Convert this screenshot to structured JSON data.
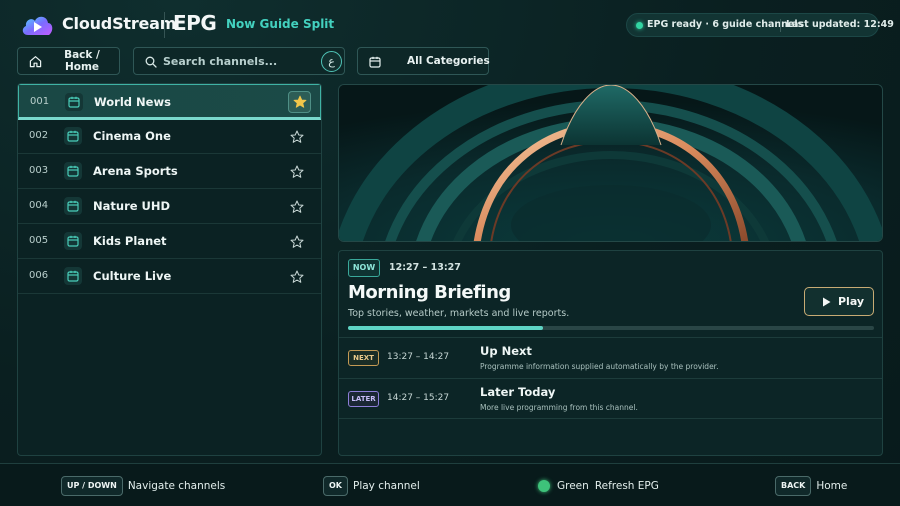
{
  "app": {
    "brand": "CloudStream",
    "section": "EPG",
    "view": "Now Guide Split"
  },
  "status": {
    "ready_text": "EPG ready · 6 guide channels",
    "updated_text": "Last updated: 12:49"
  },
  "toolbar": {
    "home_label": "Back / Home",
    "search_placeholder": "Search channels...",
    "search_value": "",
    "keyboard_badge": "ع",
    "category_label": "All Categories"
  },
  "channels": [
    {
      "number": "001",
      "name": "World News",
      "favorite": true,
      "selected": true
    },
    {
      "number": "002",
      "name": "Cinema One",
      "favorite": false,
      "selected": false
    },
    {
      "number": "003",
      "name": "Arena Sports",
      "favorite": false,
      "selected": false
    },
    {
      "number": "004",
      "name": "Nature UHD",
      "favorite": false,
      "selected": false
    },
    {
      "number": "005",
      "name": "Kids Planet",
      "favorite": false,
      "selected": false
    },
    {
      "number": "006",
      "name": "Culture Live",
      "favorite": false,
      "selected": false
    }
  ],
  "now": {
    "tag": "NOW",
    "time": "12:27 – 13:27",
    "title": "Morning Briefing",
    "description": "Top stories, weather, markets and live reports.",
    "progress": 0.37,
    "play_label": "Play"
  },
  "schedule": [
    {
      "tag": "NEXT",
      "time": "13:27 – 14:27",
      "title": "Up Next",
      "description": "Programme information supplied automatically by the provider."
    },
    {
      "tag": "LATER",
      "time": "14:27 – 15:27",
      "title": "Later Today",
      "description": "More live programming from this channel."
    }
  ],
  "footer": [
    {
      "key": "UP / DOWN",
      "text": "Navigate channels"
    },
    {
      "key": "OK",
      "text": "Play channel"
    },
    {
      "key": "",
      "color_key": "Green",
      "text": "Refresh EPG"
    },
    {
      "key": "BACK",
      "text": "Home"
    }
  ],
  "colors": {
    "accent": "#43d1bf",
    "background": "#0a1f20",
    "next_tag": "#c49a54",
    "later_tag": "#8d7ed8",
    "green_key": "#3ec27a"
  }
}
